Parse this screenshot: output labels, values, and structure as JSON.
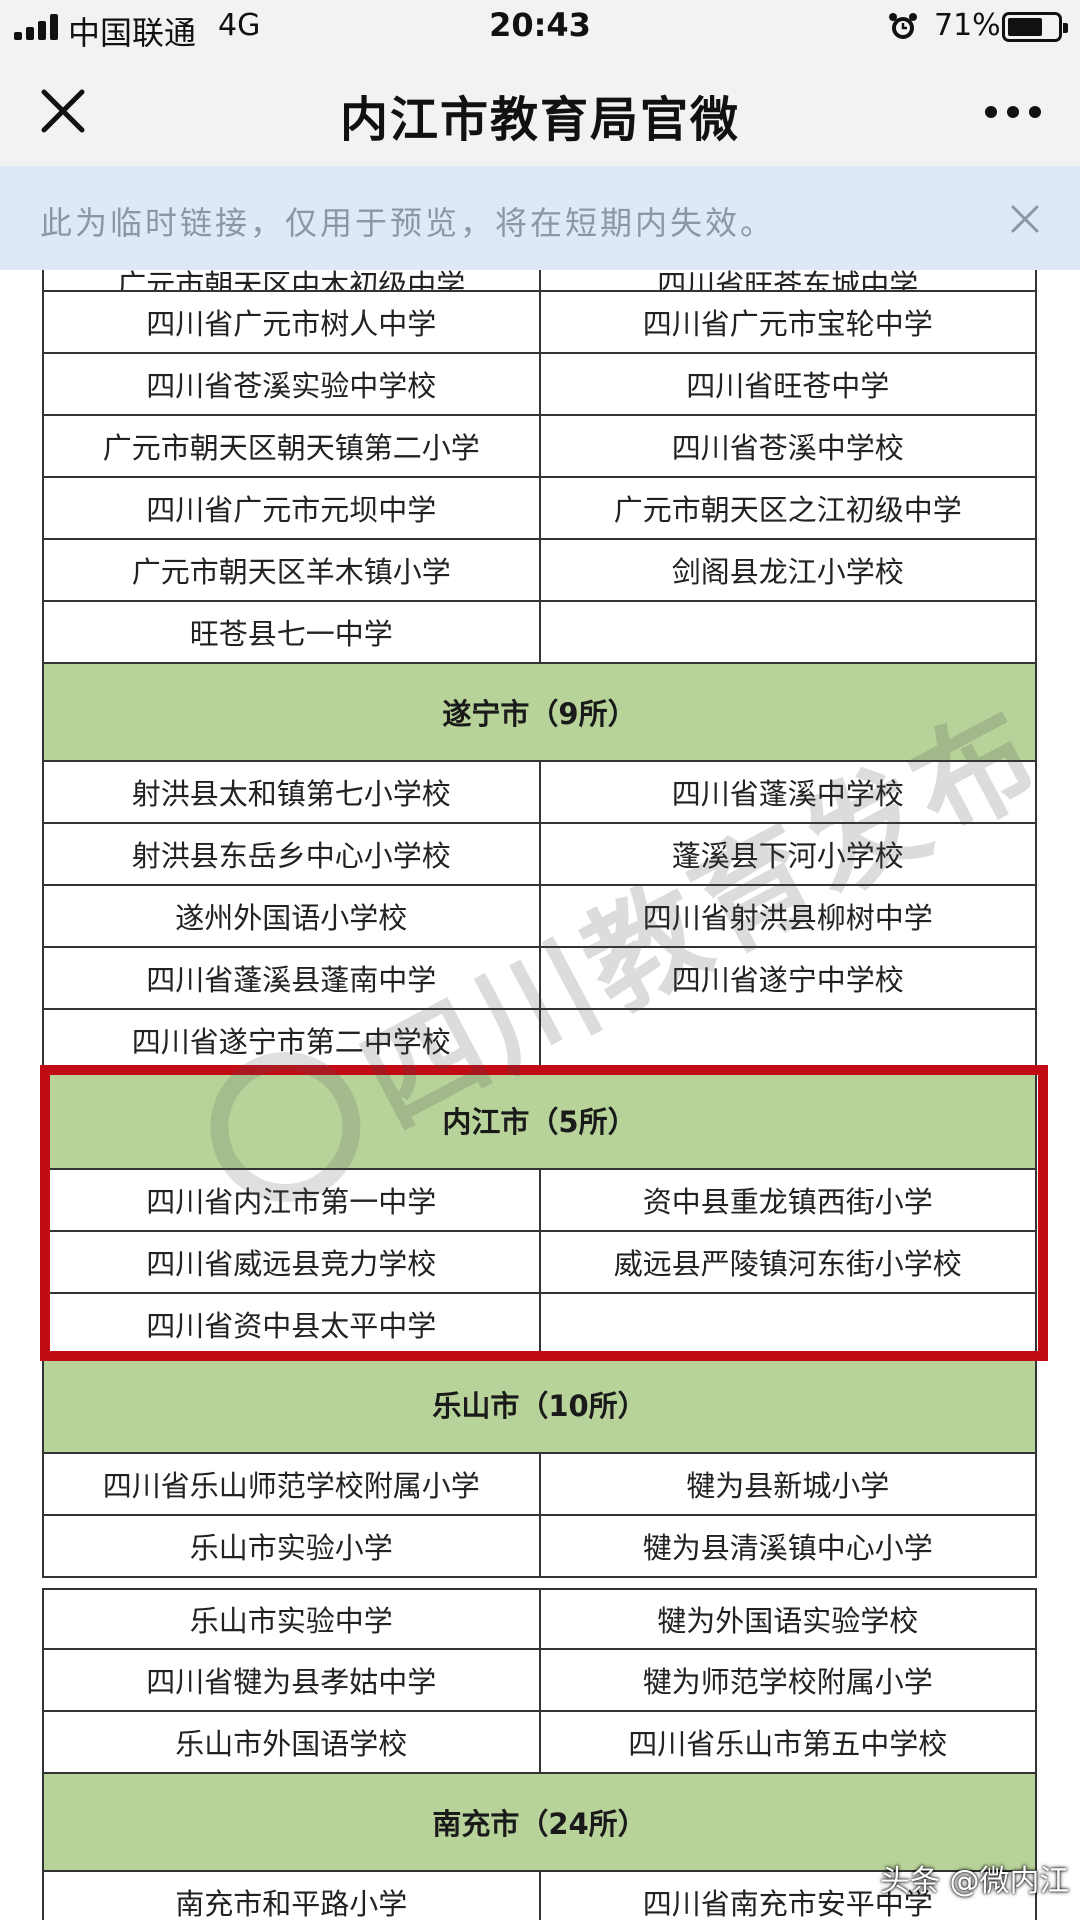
{
  "status_bar": {
    "carrier": "中国联通",
    "network": "4G",
    "time": "20:43",
    "battery": "71%",
    "battery_level": 0.71,
    "icons": [
      "signal-icon",
      "alarm-icon",
      "battery-icon"
    ]
  },
  "nav": {
    "title": "内江市教育局官微",
    "close_icon": "close-icon",
    "more_icon": "more-icon"
  },
  "notice": {
    "text": "此为临时链接，仅用于预览，将在短期内失效。",
    "close_icon": "close-icon"
  },
  "table": {
    "partial_row": [
      "广元市朝天区中木初级中学",
      "四川省旺苍东城中学"
    ],
    "guangyuan_rows": [
      [
        "四川省广元市树人中学",
        "四川省广元市宝轮中学"
      ],
      [
        "四川省苍溪实验中学校",
        "四川省旺苍中学"
      ],
      [
        "广元市朝天区朝天镇第二小学",
        "四川省苍溪中学校"
      ],
      [
        "四川省广元市元坝中学",
        "广元市朝天区之江初级中学"
      ],
      [
        "广元市朝天区羊木镇小学",
        "剑阁县龙江小学校"
      ],
      [
        "旺苍县七一中学",
        ""
      ]
    ],
    "suining": {
      "header": "遂宁市（9所）",
      "rows": [
        [
          "射洪县太和镇第七小学校",
          "四川省蓬溪中学校"
        ],
        [
          "射洪县东岳乡中心小学校",
          "蓬溪县下河小学校"
        ],
        [
          "遂州外国语小学校",
          "四川省射洪县柳树中学"
        ],
        [
          "四川省蓬溪县蓬南中学",
          "四川省遂宁中学校"
        ],
        [
          "四川省遂宁市第二中学校",
          ""
        ]
      ]
    },
    "neijiang": {
      "header": "内江市（5所）",
      "rows": [
        [
          "四川省内江市第一中学",
          "资中县重龙镇西街小学"
        ],
        [
          "四川省威远县竞力学校",
          "威远县严陵镇河东街小学校"
        ],
        [
          "四川省资中县太平中学",
          ""
        ]
      ]
    },
    "leshan": {
      "header": "乐山市（10所）",
      "rows_a": [
        [
          "四川省乐山师范学校附属小学",
          "犍为县新城小学"
        ],
        [
          "乐山市实验小学",
          "犍为县清溪镇中心小学"
        ]
      ],
      "rows_b": [
        [
          "乐山市实验中学",
          "犍为外国语实验学校"
        ],
        [
          "四川省犍为县孝姑中学",
          "犍为师范学校附属小学"
        ],
        [
          "乐山市外国语学校",
          "四川省乐山市第五中学校"
        ]
      ]
    },
    "nanchong": {
      "header": "南充市（24所）",
      "rows": [
        [
          "南充市和平路小学",
          "四川省南充市安平中学"
        ]
      ]
    }
  },
  "watermark": "四川教育发布",
  "corner_tag": "头条 @微内江",
  "colors": {
    "header_green": "#b8d39a",
    "highlight_red": "#c10c15",
    "notice_bg": "#dfe9f6",
    "notice_text": "#8b96a8"
  }
}
